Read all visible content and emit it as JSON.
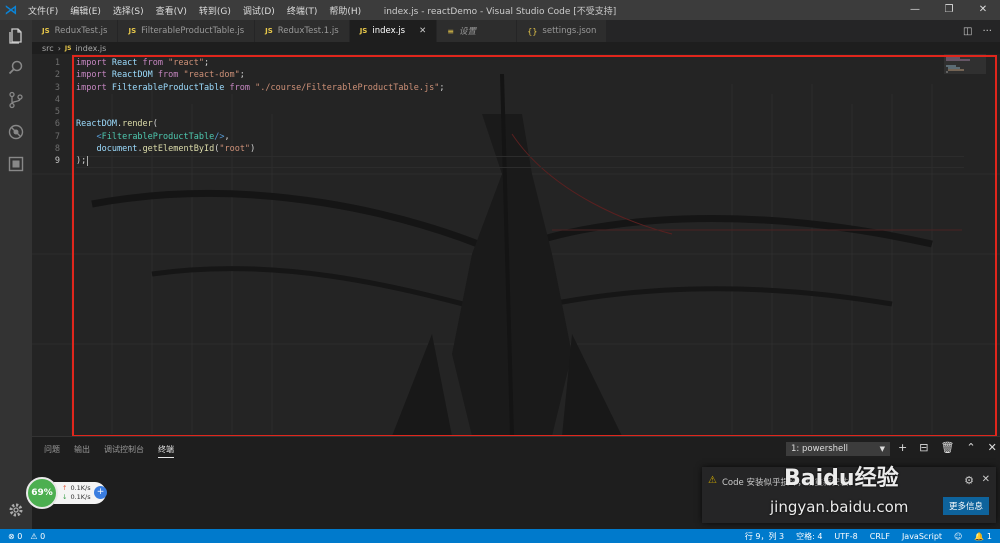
{
  "window": {
    "title": "index.js - reactDemo - Visual Studio Code [不受支持]",
    "menu": [
      "文件(F)",
      "编辑(E)",
      "选择(S)",
      "查看(V)",
      "转到(G)",
      "调试(D)",
      "终端(T)",
      "帮助(H)"
    ],
    "controls": [
      "—",
      "❐",
      "✕"
    ]
  },
  "activity_bar": [
    "files-icon",
    "search-icon",
    "source-control-icon",
    "debug-icon",
    "extensions-icon",
    "gear-icon"
  ],
  "tabs": [
    {
      "label": "ReduxTest.js",
      "badge": "JS",
      "active": false
    },
    {
      "label": "FilterableProductTable.js",
      "badge": "JS",
      "active": false
    },
    {
      "label": "ReduxTest.1.js",
      "badge": "JS",
      "active": false
    },
    {
      "label": "index.js",
      "badge": "JS",
      "active": true,
      "close": "✕"
    },
    {
      "label": "设置",
      "badge": "≡",
      "active": false
    },
    {
      "label": "settings.json",
      "badge": "{}",
      "active": false
    }
  ],
  "breadcrumb": {
    "folder": "src",
    "sep": "›",
    "badge": "JS",
    "file": "index.js"
  },
  "editor": {
    "line_numbers": [
      "1",
      "2",
      "3",
      "4",
      "5",
      "6",
      "7",
      "8",
      "9"
    ],
    "current_line": "9"
  },
  "panel": {
    "tabs": [
      "问题",
      "输出",
      "调试控制台",
      "终端"
    ],
    "active_tab": "终端",
    "terminal_select": "1: powershell",
    "actions": [
      "+",
      "⊟",
      "🗑",
      "⌃",
      "✕"
    ]
  },
  "notification": {
    "message": "Code 安装似乎损坏，请重新安装。",
    "button": "更多信息"
  },
  "speed_widget": {
    "percent": "69%",
    "up": "0.1K/s",
    "down": "0.1K/s"
  },
  "status_bar": {
    "errors": "0",
    "warnings": "0",
    "position": "行 9，列 3",
    "spaces": "空格: 4",
    "encoding": "UTF-8",
    "eol": "CRLF",
    "language": "JavaScript",
    "notifications": "1"
  },
  "watermark": {
    "brand": "Baidu经验",
    "url": "jingyan.baidu.com"
  },
  "colors": {
    "accent": "#007acc",
    "highlight_box": "#e0261c"
  }
}
